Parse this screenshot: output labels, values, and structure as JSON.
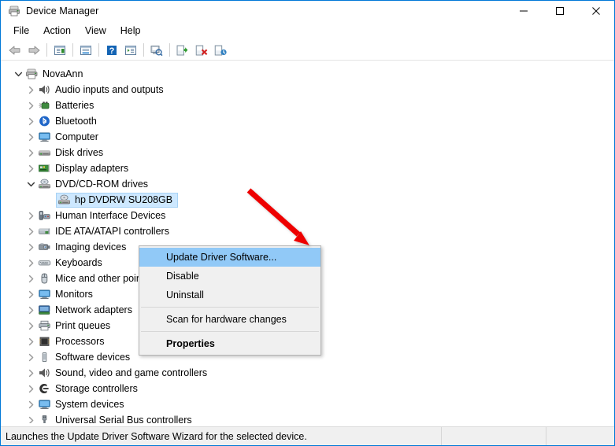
{
  "window": {
    "title": "Device Manager",
    "icon": "device-manager-icon",
    "controls": [
      {
        "name": "minimize-button",
        "glyph": "minimize"
      },
      {
        "name": "maximize-button",
        "glyph": "maximize"
      },
      {
        "name": "close-button",
        "glyph": "close"
      }
    ]
  },
  "menubar": {
    "items": [
      {
        "label": "File"
      },
      {
        "label": "Action"
      },
      {
        "label": "View"
      },
      {
        "label": "Help"
      }
    ]
  },
  "toolbar": {
    "buttons": [
      {
        "name": "back-icon",
        "tooltip": "Back"
      },
      {
        "name": "forward-icon",
        "tooltip": "Forward"
      },
      {
        "name": "show-hide-console-tree-icon",
        "tooltip": "Show/Hide Console Tree"
      },
      {
        "name": "properties-icon",
        "tooltip": "Properties"
      },
      {
        "name": "help-icon",
        "tooltip": "Help"
      },
      {
        "name": "show-hide-action-pane-icon",
        "tooltip": "Show/Hide Action Pane"
      },
      {
        "name": "scan-for-hardware-changes-icon",
        "tooltip": "Scan for hardware changes"
      },
      {
        "name": "update-driver-software-icon",
        "tooltip": "Update Driver Software"
      },
      {
        "name": "uninstall-device-icon",
        "tooltip": "Uninstall"
      },
      {
        "name": "disable-device-icon",
        "tooltip": "Disable"
      }
    ]
  },
  "tree": {
    "nodes": [
      {
        "label": "NovaAnn",
        "level": 0,
        "expander": "expanded",
        "icon": "computer-root-icon",
        "selected": false
      },
      {
        "label": "Audio inputs and outputs",
        "level": 1,
        "expander": "collapsed",
        "icon": "speaker-icon",
        "selected": false
      },
      {
        "label": "Batteries",
        "level": 1,
        "expander": "collapsed",
        "icon": "battery-icon",
        "selected": false
      },
      {
        "label": "Bluetooth",
        "level": 1,
        "expander": "collapsed",
        "icon": "bluetooth-icon",
        "selected": false
      },
      {
        "label": "Computer",
        "level": 1,
        "expander": "collapsed",
        "icon": "monitor-icon",
        "selected": false
      },
      {
        "label": "Disk drives",
        "level": 1,
        "expander": "collapsed",
        "icon": "disk-drive-icon",
        "selected": false
      },
      {
        "label": "Display adapters",
        "level": 1,
        "expander": "collapsed",
        "icon": "display-adapter-icon",
        "selected": false
      },
      {
        "label": "DVD/CD-ROM drives",
        "level": 1,
        "expander": "expanded",
        "icon": "optical-drive-icon",
        "selected": false
      },
      {
        "label": "hp DVDRW  SU208GB",
        "level": 2,
        "expander": "none",
        "icon": "optical-drive-icon",
        "selected": true
      },
      {
        "label": "Human Interface Devices",
        "level": 1,
        "expander": "collapsed",
        "icon": "hid-icon",
        "selected": false
      },
      {
        "label": "IDE ATA/ATAPI controllers",
        "level": 1,
        "expander": "collapsed",
        "icon": "ide-controller-icon",
        "selected": false
      },
      {
        "label": "Imaging devices",
        "level": 1,
        "expander": "collapsed",
        "icon": "camera-icon",
        "selected": false
      },
      {
        "label": "Keyboards",
        "level": 1,
        "expander": "collapsed",
        "icon": "keyboard-icon",
        "selected": false
      },
      {
        "label": "Mice and other pointing devices",
        "level": 1,
        "expander": "collapsed",
        "icon": "mouse-icon",
        "selected": false
      },
      {
        "label": "Monitors",
        "level": 1,
        "expander": "collapsed",
        "icon": "monitor-icon",
        "selected": false
      },
      {
        "label": "Network adapters",
        "level": 1,
        "expander": "collapsed",
        "icon": "network-adapter-icon",
        "selected": false
      },
      {
        "label": "Print queues",
        "level": 1,
        "expander": "collapsed",
        "icon": "printer-icon",
        "selected": false
      },
      {
        "label": "Processors",
        "level": 1,
        "expander": "collapsed",
        "icon": "processor-icon",
        "selected": false
      },
      {
        "label": "Software devices",
        "level": 1,
        "expander": "collapsed",
        "icon": "software-device-icon",
        "selected": false
      },
      {
        "label": "Sound, video and game controllers",
        "level": 1,
        "expander": "collapsed",
        "icon": "speaker-icon",
        "selected": false
      },
      {
        "label": "Storage controllers",
        "level": 1,
        "expander": "collapsed",
        "icon": "storage-controller-icon",
        "selected": false
      },
      {
        "label": "System devices",
        "level": 1,
        "expander": "collapsed",
        "icon": "monitor-icon",
        "selected": false
      },
      {
        "label": "Universal Serial Bus controllers",
        "level": 1,
        "expander": "collapsed",
        "icon": "usb-icon",
        "selected": false
      }
    ]
  },
  "context_menu": {
    "items": [
      {
        "label": "Update Driver Software...",
        "highlighted": true,
        "bold": false,
        "type": "item"
      },
      {
        "label": "Disable",
        "highlighted": false,
        "bold": false,
        "type": "item"
      },
      {
        "label": "Uninstall",
        "highlighted": false,
        "bold": false,
        "type": "item"
      },
      {
        "type": "separator"
      },
      {
        "label": "Scan for hardware changes",
        "highlighted": false,
        "bold": false,
        "type": "item"
      },
      {
        "type": "separator"
      },
      {
        "label": "Properties",
        "highlighted": false,
        "bold": true,
        "type": "item"
      }
    ]
  },
  "annotation": {
    "arrow": {
      "name": "red-arrow-annotation",
      "color": "#ee0000"
    }
  },
  "statusbar": {
    "message": "Launches the Update Driver Software Wizard for the selected device.",
    "panel2": "",
    "panel3": ""
  },
  "colors": {
    "selection_fill": "#cde8ff",
    "selection_border": "#a7d2f5",
    "menu_highlight": "#91c9f7",
    "menu_bg": "#f0f0f0",
    "window_border": "#0078d7",
    "arrow_red": "#ee0000"
  }
}
